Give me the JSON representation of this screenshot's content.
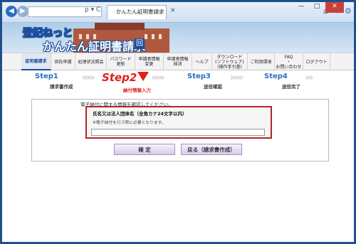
{
  "browser": {
    "address": "",
    "addr_controls": "ρ ▾ C",
    "tab_title": "かんたん証明書請求 - 納付…",
    "tab_close": "×",
    "icons": [
      "home-icon",
      "star-icon",
      "settings-icon"
    ]
  },
  "window_controls": {
    "minimize": "—",
    "maximize": "□",
    "close": "✕"
  },
  "banner": {
    "logo_line1": "登記ねっと",
    "logo_line2": "かんたん証明書請求",
    "logo_badge": "回"
  },
  "menu": {
    "items": [
      {
        "label": "証明書請求",
        "active": true
      },
      {
        "label": "供託申請"
      },
      {
        "label": "処理状況照会"
      },
      {
        "label": "パスワード\n更新"
      },
      {
        "label": "申請者情報\n変更"
      },
      {
        "label": "申請者情報\n抹消"
      },
      {
        "label": "ヘルプ"
      },
      {
        "label": "ダウンロード\n(ソフトウェア)\n(操作手引書)"
      },
      {
        "label": "ご利用環境"
      },
      {
        "label": "FAQ\n・\nお問い合わせ"
      },
      {
        "label": "ログアウト"
      }
    ]
  },
  "steps": [
    {
      "number": "Step1",
      "label": "請求書作成"
    },
    {
      "number": "Step2",
      "label": "納付情報入力",
      "current": true
    },
    {
      "number": "Step3",
      "label": "送信確認"
    },
    {
      "number": "Step4",
      "label": "送信完了"
    }
  ],
  "form": {
    "intro": "電子納付に関する情報を確認してください。",
    "field_label": "氏名又は法人団体名（全角カナ24文字以内）",
    "field_note": "※電子納付を行う際に必要となります。",
    "field_value": ""
  },
  "buttons": {
    "confirm": "確 定",
    "back": "戻る（請求書作成）"
  },
  "colors": {
    "accent_blue": "#1a4f9a",
    "current_red": "#e0201a",
    "field_border": "#b8232c",
    "button_purple": "#d9cce7"
  }
}
